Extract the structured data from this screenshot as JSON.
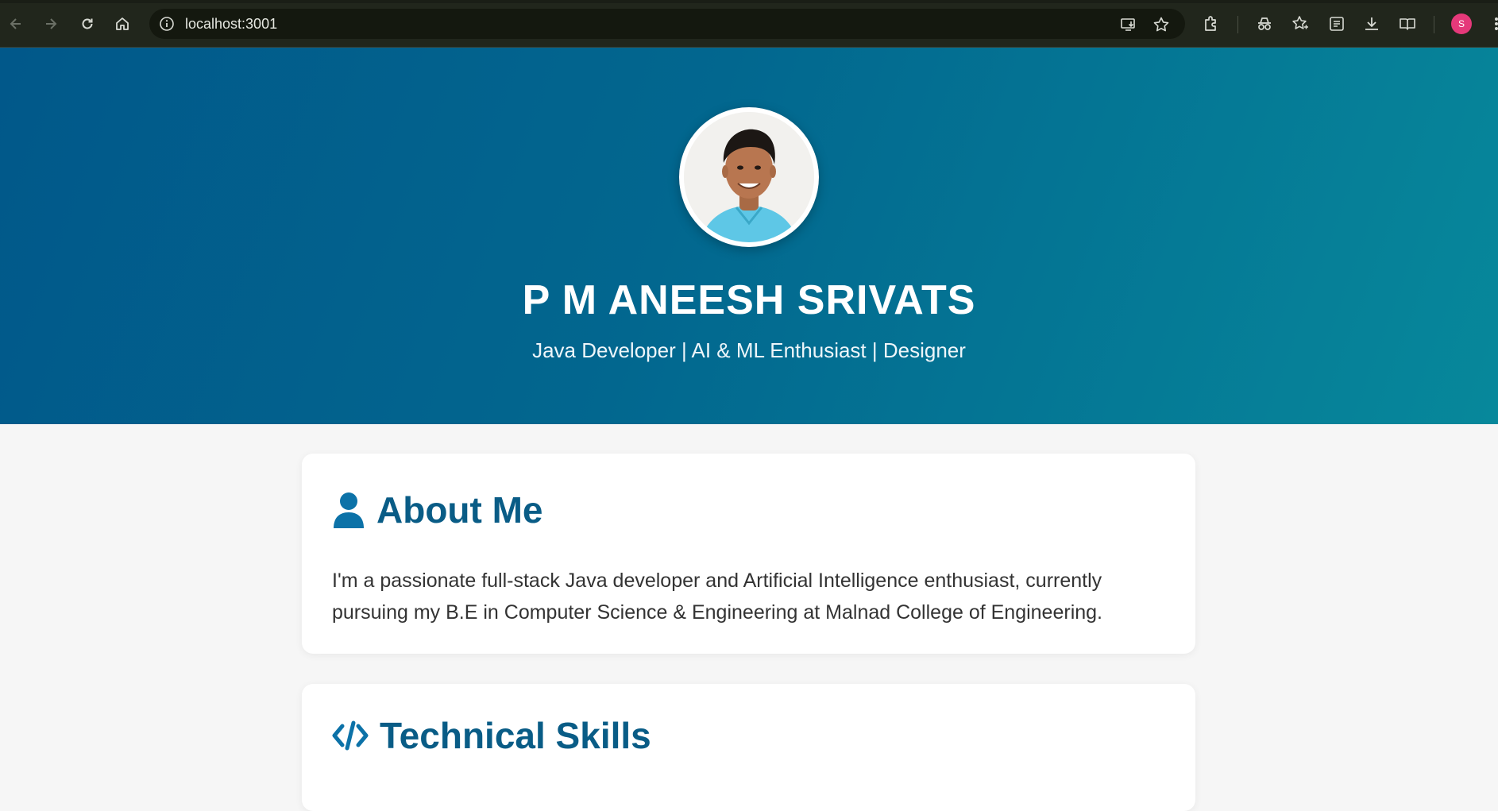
{
  "browser": {
    "url": "localhost:3001",
    "profile_initial": "S"
  },
  "hero": {
    "name": "P M ANEESH SRIVATS",
    "subtitle": "Java Developer | AI & ML Enthusiast | Designer"
  },
  "about": {
    "title": "About Me",
    "icon": "user-icon",
    "text": "I'm a passionate full-stack Java developer and Artificial Intelligence enthusiast, currently pursuing my B.E in Computer Science & Engineering at Malnad College of Engineering."
  },
  "skills": {
    "title": "Technical Skills",
    "icon": "code-icon"
  },
  "colors": {
    "hero_start": "#01588a",
    "hero_end": "#07889b",
    "heading": "#095c86",
    "page_bg": "#f6f6f6"
  }
}
